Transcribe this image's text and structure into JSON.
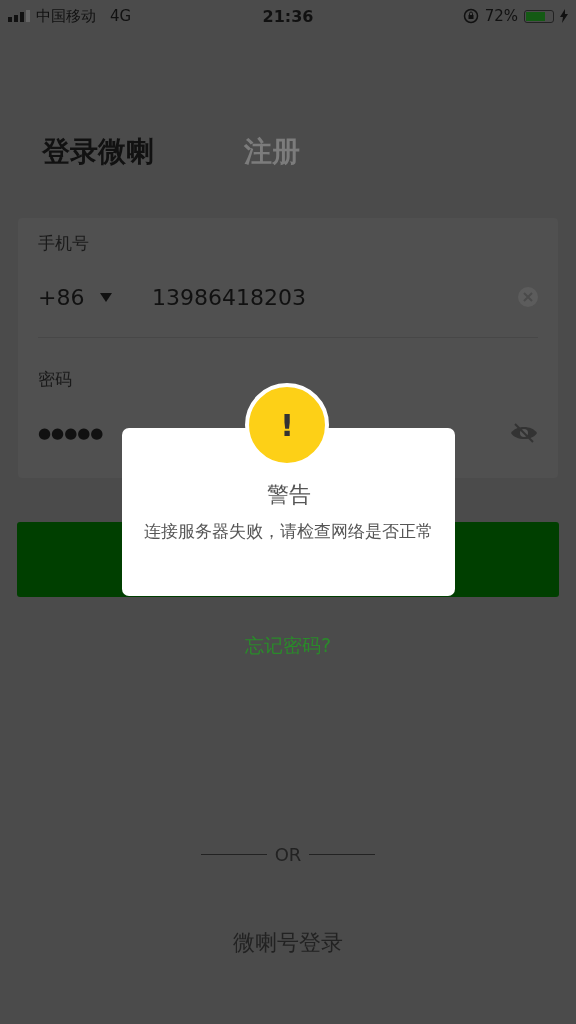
{
  "status_bar": {
    "carrier": "中国移动",
    "network": "4G",
    "time": "21:36",
    "battery_percent": "72%"
  },
  "tabs": [
    {
      "label": "登录微喇",
      "selected": true
    },
    {
      "label": "注册",
      "selected": false
    }
  ],
  "phone": {
    "label": "手机号",
    "country_code": "+86",
    "value": "13986418203"
  },
  "password": {
    "label": "密码",
    "value": "●●●●●"
  },
  "forgot_link": "忘记密码?",
  "divider_text": "OR",
  "alt_login": "微喇号登录",
  "alert": {
    "title": "警告",
    "message": "连接服务器失败，请检查网络是否正常",
    "icon_text": "!"
  }
}
